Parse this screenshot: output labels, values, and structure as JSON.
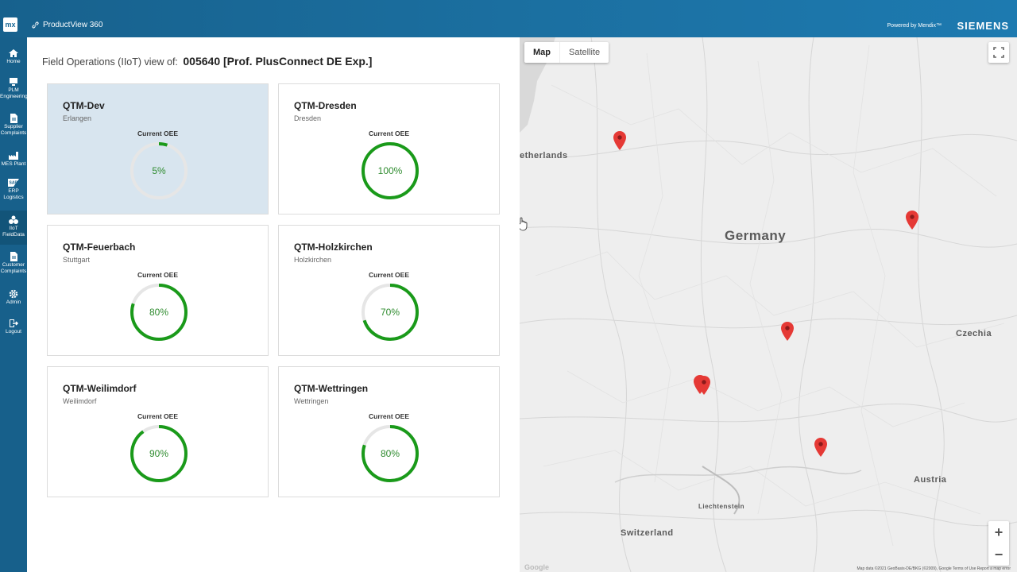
{
  "topbar": {
    "logo": "mx",
    "app_title": "ProductView 360",
    "powered_by": "Powered by Mendix™",
    "brand": "SIEMENS"
  },
  "sidebar": {
    "items": [
      {
        "label": "Home",
        "icon": "home-icon"
      },
      {
        "label": "PLM\nEngineering",
        "line1": "PLM",
        "line2": "Engineering",
        "icon": "monitor-icon"
      },
      {
        "label": "Supplier Complaints",
        "line1": "Supplier",
        "line2": "Complaints",
        "icon": "document-icon"
      },
      {
        "label": "MES Plant",
        "line1": "MES Plant",
        "line2": "",
        "icon": "factory-icon"
      },
      {
        "label": "ERP Logistics",
        "line1": "ERP",
        "line2": "Logistics",
        "icon": "sap-icon"
      },
      {
        "label": "IIoT FieldData",
        "line1": "IIoT",
        "line2": "FieldData",
        "icon": "iot-icon"
      },
      {
        "label": "Customer Complaints",
        "line1": "Customer",
        "line2": "Complaints",
        "icon": "document-icon"
      },
      {
        "label": "Admin",
        "line1": "Admin",
        "line2": "",
        "icon": "gear-icon"
      },
      {
        "label": "Logout",
        "line1": "Logout",
        "line2": "",
        "icon": "logout-icon"
      }
    ]
  },
  "main": {
    "heading_prefix": "Field Operations (IIoT) view of:",
    "heading_asset": "005640 [Prof. PlusConnect DE Exp.]",
    "oee_label": "Current OEE",
    "sites": [
      {
        "name": "QTM-Dev",
        "city": "Erlangen",
        "oee": 5,
        "oee_text": "5%"
      },
      {
        "name": "QTM-Dresden",
        "city": "Dresden",
        "oee": 100,
        "oee_text": "100%"
      },
      {
        "name": "QTM-Feuerbach",
        "city": "Stuttgart",
        "oee": 80,
        "oee_text": "80%"
      },
      {
        "name": "QTM-Holzkirchen",
        "city": "Holzkirchen",
        "oee": 70,
        "oee_text": "70%"
      },
      {
        "name": "QTM-Weilimdorf",
        "city": "Weilimdorf",
        "oee": 90,
        "oee_text": "90%"
      },
      {
        "name": "QTM-Wettringen",
        "city": "Wettringen",
        "oee": 80,
        "oee_text": "80%"
      }
    ]
  },
  "map": {
    "tab_map": "Map",
    "tab_satellite": "Satellite",
    "zoom_in": "+",
    "zoom_out": "−",
    "labels": {
      "netherlands": "etherlands",
      "germany": "Germany",
      "czechia": "Czechia",
      "austria": "Austria",
      "liechtenstein": "Liechtenstein",
      "switzerland": "Switzerland"
    },
    "footer": "Map data ©2021 GeoBasis-DE/BKG (©2009), Google   Terms of Use   Report a map error",
    "google": "Google"
  },
  "colors": {
    "accent": "#17608b",
    "gauge_green": "#1a9a1a",
    "gauge_track": "#e6e6e6",
    "selected_card": "#d8e5ef",
    "pin": "#e53935"
  }
}
